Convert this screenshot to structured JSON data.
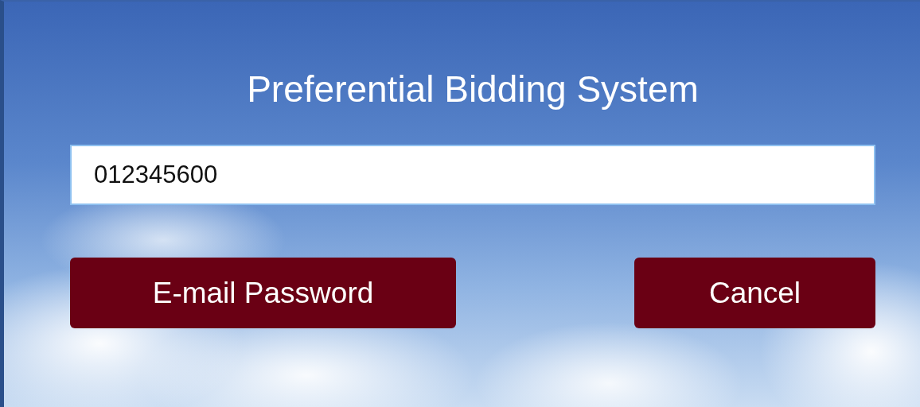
{
  "title": "Preferential Bidding System",
  "field": {
    "value": "012345600"
  },
  "buttons": [
    {
      "label": "E-mail Password"
    },
    {
      "label": "Cancel"
    }
  ]
}
